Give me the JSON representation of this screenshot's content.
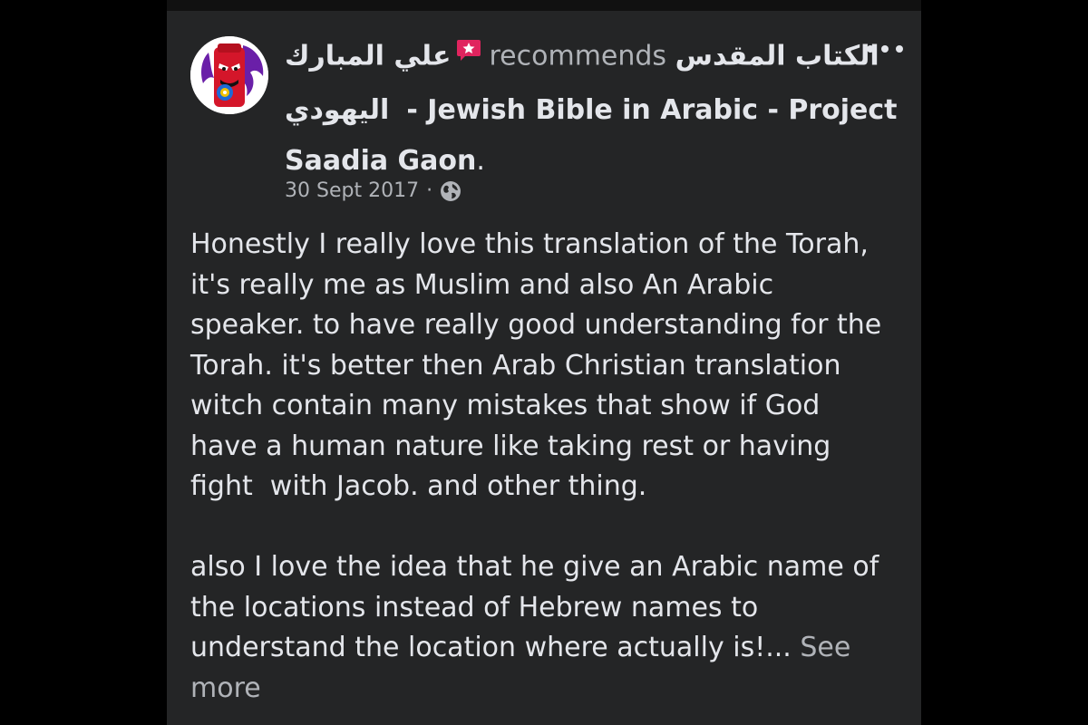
{
  "post": {
    "author_name": "علي المبارك",
    "action_text": "recommends",
    "page_name_arabic_1": "الكتاب المقدس",
    "page_name_arabic_2": "اليهودي",
    "page_name_english_1": "- Jewish Bible in Arabic - Project",
    "page_name_english_2": "Saadia Gaon",
    "trailing_period": ".",
    "date": "30 Sept 2017",
    "separator": "·",
    "privacy_icon": "globe-icon",
    "more_icon": "ellipsis-icon",
    "badge_icon": "star-badge-icon",
    "body_paragraph_1": [
      "Honestly I really love this translation of the Torah,",
      "it's really me as Muslim and also An Arabic",
      "speaker. to have really good understanding for the",
      "Torah. it's better then Arab Christian translation",
      "witch contain many mistakes that show if God",
      "have a human nature like taking rest or having",
      "fight  with Jacob. and other thing."
    ],
    "body_paragraph_2": [
      "also I love the idea that he give an Arabic name of",
      "the locations instead of Hebrew names to",
      "understand the location where actually is!..."
    ],
    "see_more_label_1": "See",
    "see_more_label_2": "more"
  },
  "colors": {
    "card_background": "#242526",
    "page_background": "#000000",
    "primary_text": "#e4e6eb",
    "secondary_text": "#b0b3b8",
    "badge_red": "#e0245e"
  }
}
